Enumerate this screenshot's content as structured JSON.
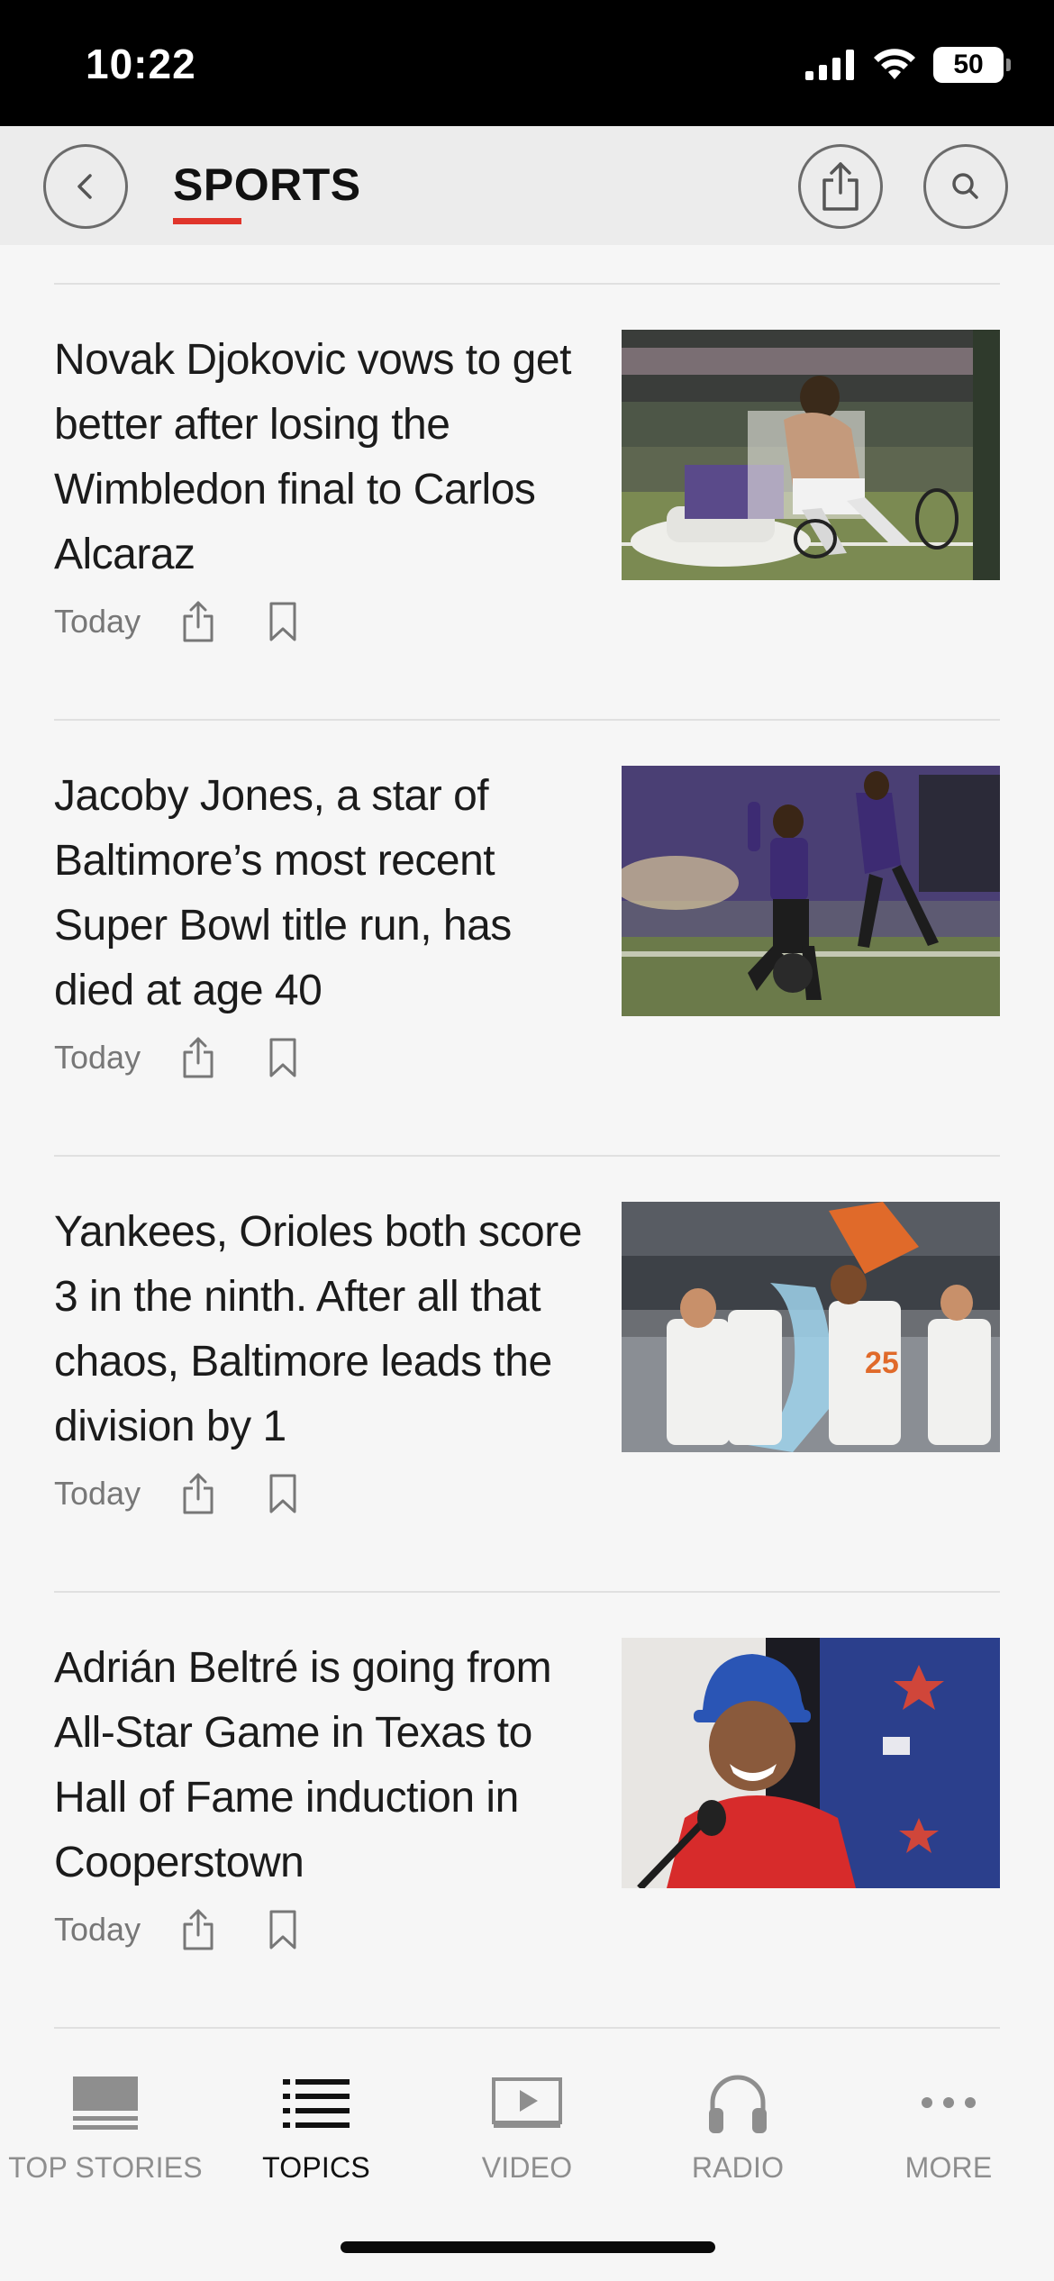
{
  "status_bar": {
    "time": "10:22",
    "battery": "50"
  },
  "header": {
    "title": "SPORTS",
    "accent_color": "#e0352b"
  },
  "articles": [
    {
      "headline": "Novak Djokovic vows to get better after losing the Wimbledon final to Carlos Alcaraz",
      "date": "Today",
      "image": "tennis-player-seated-on-court"
    },
    {
      "headline": "Jacoby Jones, a star of Baltimore’s most recent Super Bowl title run, has died at age 40",
      "date": "Today",
      "image": "football-player-kneeling-celebration"
    },
    {
      "headline": "Yankees, Orioles both score 3 in the ninth. After all that chaos, Baltimore leads the division by 1",
      "date": "Today",
      "image": "orioles-players-water-cooler-celebration"
    },
    {
      "headline": "Adrián Beltré is going from All-Star Game in Texas to Hall of Fame induction in Cooperstown",
      "date": "Today",
      "image": "player-at-press-conference-microphone"
    }
  ],
  "tabs": [
    {
      "label": "TOP STORIES",
      "icon": "top-stories-icon"
    },
    {
      "label": "TOPICS",
      "icon": "topics-list-icon"
    },
    {
      "label": "VIDEO",
      "icon": "video-play-icon"
    },
    {
      "label": "RADIO",
      "icon": "headphones-icon"
    },
    {
      "label": "MORE",
      "icon": "more-dots-icon"
    }
  ]
}
